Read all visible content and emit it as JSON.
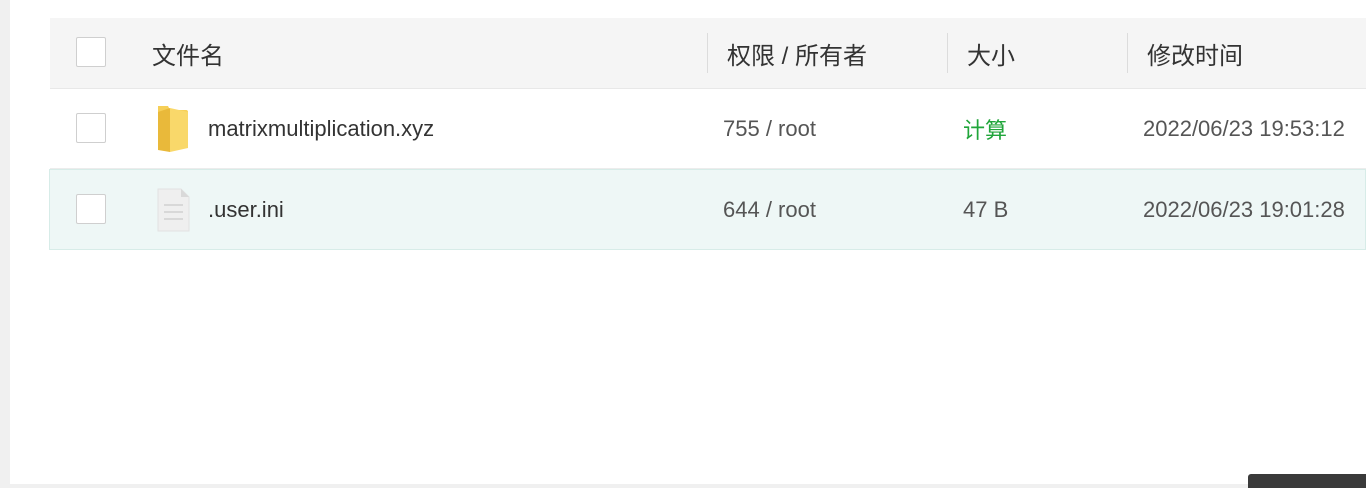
{
  "table": {
    "headers": {
      "name": "文件名",
      "permission": "权限 / 所有者",
      "size": "大小",
      "modified": "修改时间"
    },
    "rows": [
      {
        "type": "folder",
        "icon": "folder-icon",
        "name": "matrixmultiplication.xyz",
        "permission": "755 / root",
        "size": "计算",
        "size_is_action": true,
        "modified": "2022/06/23 19:53:12"
      },
      {
        "type": "file",
        "icon": "file-icon",
        "name": ".user.ini",
        "permission": "644 / root",
        "size": "47 B",
        "size_is_action": false,
        "modified": "2022/06/23 19:01:28"
      }
    ]
  },
  "colors": {
    "accent_green": "#20a53a",
    "header_bg": "#f5f5f5",
    "hover_row_bg": "#eef7f6",
    "folder_yellow": "#f6cf57"
  }
}
